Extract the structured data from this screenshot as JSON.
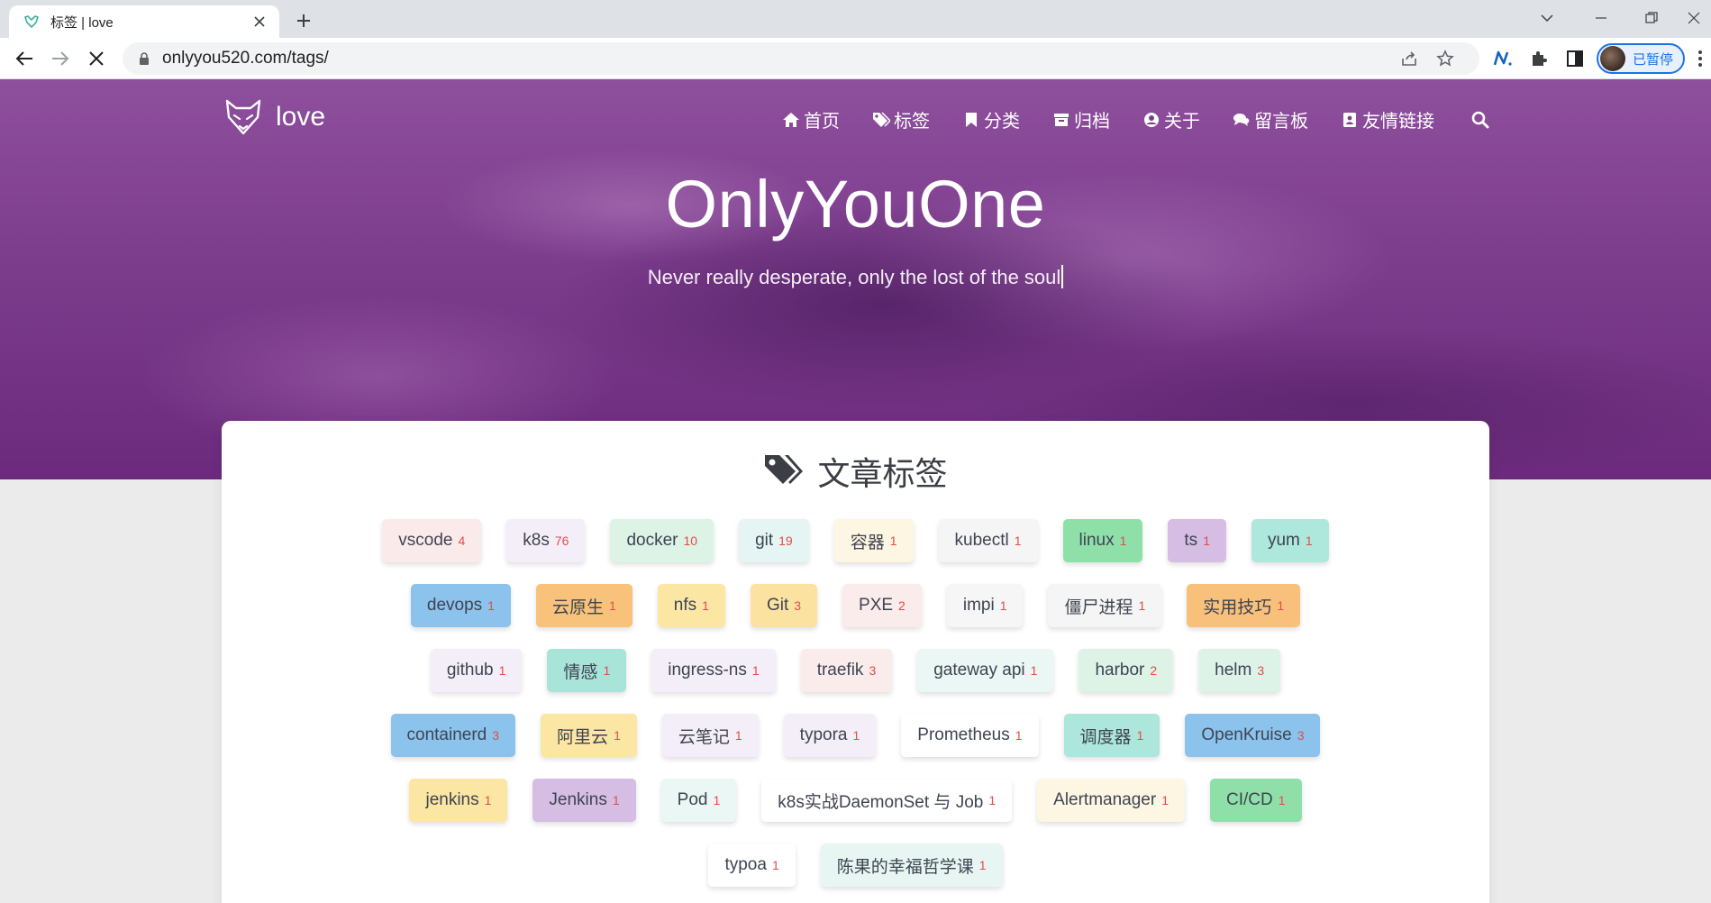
{
  "browser": {
    "tab_title": "标签 | love",
    "url": "onlyyou520.com/tags/",
    "profile_label": "已暂停"
  },
  "site": {
    "logo_text": "love",
    "nav": [
      {
        "label": "首页",
        "icon": "home-icon"
      },
      {
        "label": "标签",
        "icon": "tags-icon"
      },
      {
        "label": "分类",
        "icon": "bookmark-icon"
      },
      {
        "label": "归档",
        "icon": "archive-icon"
      },
      {
        "label": "关于",
        "icon": "user-circle-icon"
      },
      {
        "label": "留言板",
        "icon": "comments-icon"
      },
      {
        "label": "友情链接",
        "icon": "address-book-icon"
      }
    ],
    "hero_title": "OnlyYouOne",
    "hero_subtitle": "Never really desperate, only the lost of the soul"
  },
  "tags_section": {
    "title": "文章标签",
    "rows": [
      [
        {
          "name": "vscode",
          "count": "4",
          "bg": "#fbeaea"
        },
        {
          "name": "k8s",
          "count": "76",
          "bg": "#f3eef8"
        },
        {
          "name": "docker",
          "count": "10",
          "bg": "#dcf3e6"
        },
        {
          "name": "git",
          "count": "19",
          "bg": "#e4f5f3"
        },
        {
          "name": "容器",
          "count": "1",
          "bg": "#fdf6e2"
        },
        {
          "name": "kubectl",
          "count": "1",
          "bg": "#f5f5f5"
        },
        {
          "name": "linux",
          "count": "1",
          "bg": "#8ee0a8"
        },
        {
          "name": "ts",
          "count": "1",
          "bg": "#d6bde3"
        },
        {
          "name": "yum",
          "count": "1",
          "bg": "#aee8dc"
        }
      ],
      [
        {
          "name": "devops",
          "count": "1",
          "bg": "#8cc3ec"
        },
        {
          "name": "云原生",
          "count": "1",
          "bg": "#f8c27a"
        },
        {
          "name": "nfs",
          "count": "1",
          "bg": "#fbe7a3"
        },
        {
          "name": "Git",
          "count": "3",
          "bg": "#fbe2a0"
        },
        {
          "name": "PXE",
          "count": "2",
          "bg": "#fbecec"
        },
        {
          "name": "impi",
          "count": "1",
          "bg": "#f6f6f6"
        },
        {
          "name": "僵尸进程",
          "count": "1",
          "bg": "#f5f5f5"
        },
        {
          "name": "实用技巧",
          "count": "1",
          "bg": "#f8c07b"
        }
      ],
      [
        {
          "name": "github",
          "count": "1",
          "bg": "#f4eef8"
        },
        {
          "name": "情感",
          "count": "1",
          "bg": "#a9e4d9"
        },
        {
          "name": "ingress-ns",
          "count": "1",
          "bg": "#f4eef8"
        },
        {
          "name": "traefik",
          "count": "3",
          "bg": "#fbecec"
        },
        {
          "name": "gateway api",
          "count": "1",
          "bg": "#eaf7f4"
        },
        {
          "name": "harbor",
          "count": "2",
          "bg": "#dcf3e6"
        },
        {
          "name": "helm",
          "count": "3",
          "bg": "#def3e8"
        }
      ],
      [
        {
          "name": "containerd",
          "count": "3",
          "bg": "#8cc3ec"
        },
        {
          "name": "阿里云",
          "count": "1",
          "bg": "#fbe7a3"
        },
        {
          "name": "云笔记",
          "count": "1",
          "bg": "#f4eef8"
        },
        {
          "name": "typora",
          "count": "1",
          "bg": "#f4eef8"
        },
        {
          "name": "Prometheus",
          "count": "1",
          "bg": "#ffffff"
        },
        {
          "name": "调度器",
          "count": "1",
          "bg": "#ade6da"
        },
        {
          "name": "OpenKruise",
          "count": "3",
          "bg": "#8cc3ec"
        }
      ],
      [
        {
          "name": "jenkins",
          "count": "1",
          "bg": "#fbe7a3"
        },
        {
          "name": "Jenkins",
          "count": "1",
          "bg": "#d6bde3"
        },
        {
          "name": "Pod",
          "count": "1",
          "bg": "#eaf7f4"
        },
        {
          "name": "k8s实战DaemonSet 与 Job",
          "count": "1",
          "bg": "#ffffff"
        },
        {
          "name": "Alertmanager",
          "count": "1",
          "bg": "#fdf6e2"
        },
        {
          "name": "CI/CD",
          "count": "1",
          "bg": "#8ee0a8"
        }
      ],
      [
        {
          "name": "typoa",
          "count": "1",
          "bg": "#ffffff"
        },
        {
          "name": "陈果的幸福哲学课",
          "count": "1",
          "bg": "#e7f6f2"
        }
      ]
    ]
  }
}
